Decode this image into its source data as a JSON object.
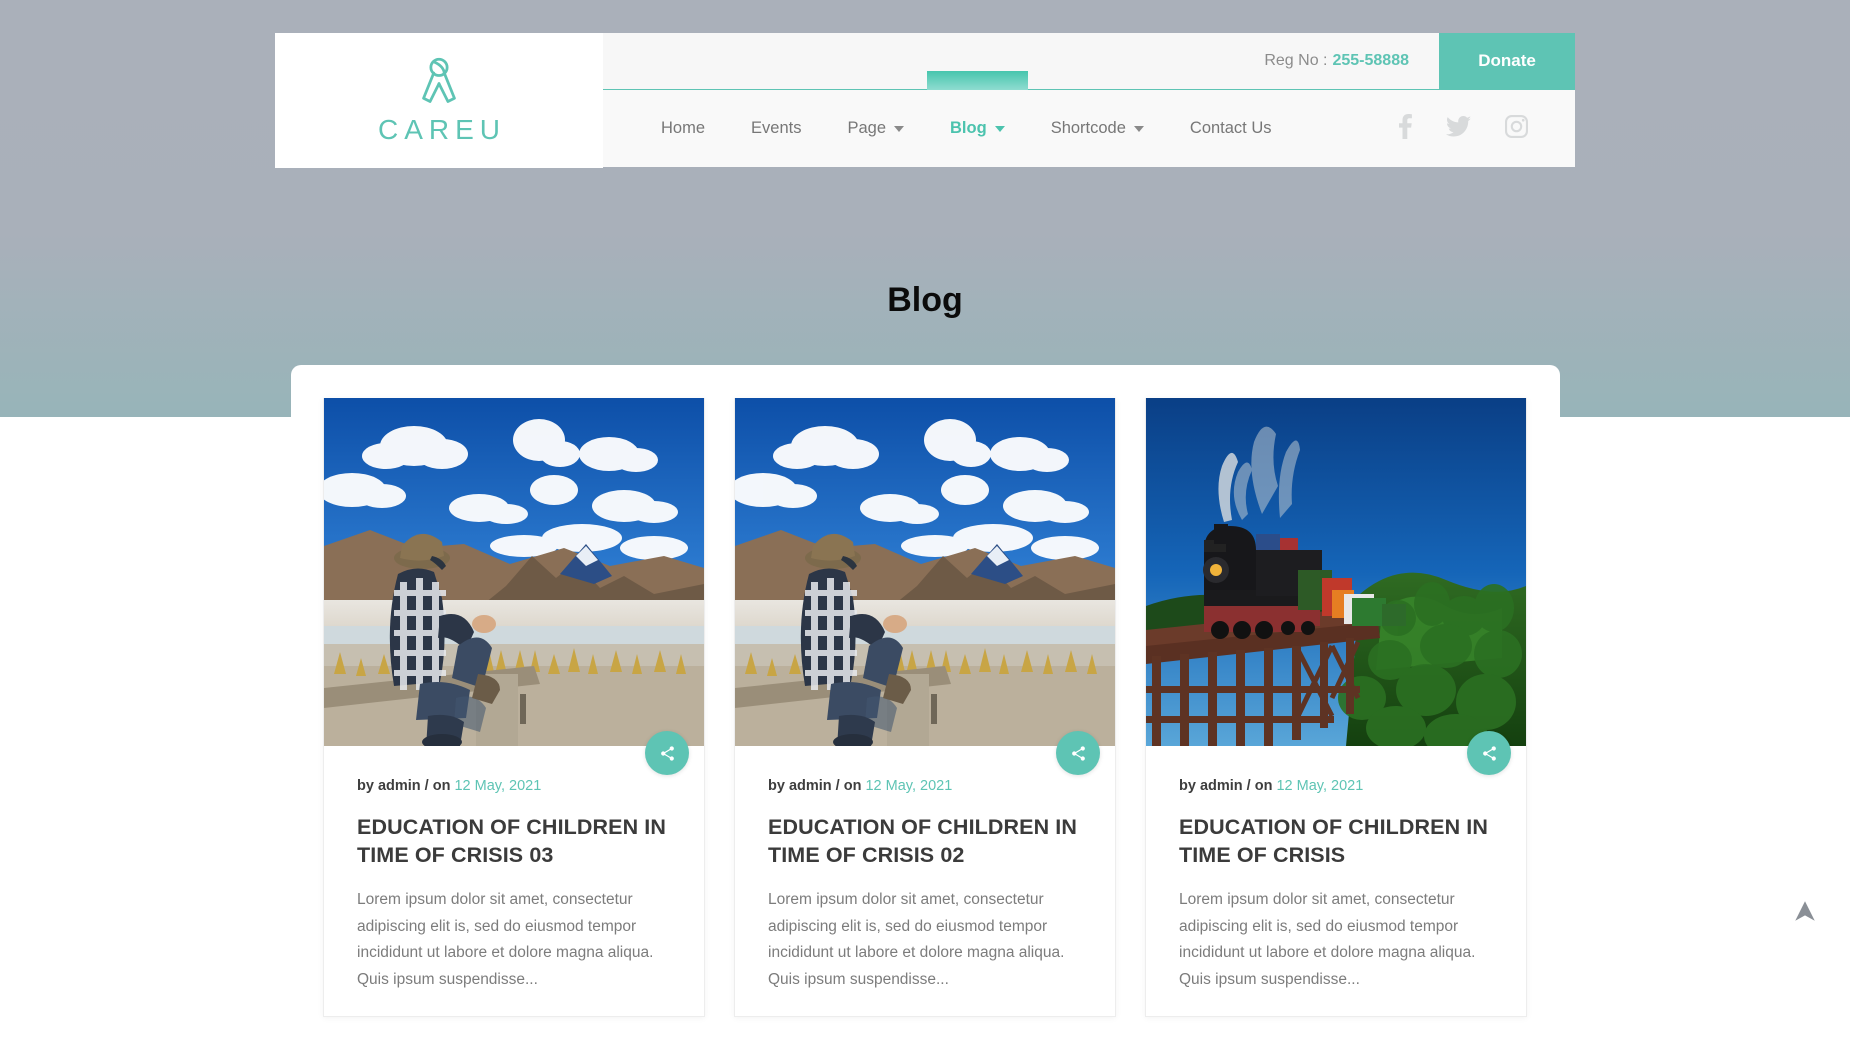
{
  "header": {
    "logo": {
      "icon": "ribbon-icon",
      "brand": "CAREU"
    },
    "topbar": {
      "reg_label": "Reg No :",
      "reg_value": "255-58888",
      "donate_label": "Donate"
    },
    "nav": [
      {
        "label": "Home",
        "has_caret": false,
        "active": false
      },
      {
        "label": "Events",
        "has_caret": false,
        "active": false
      },
      {
        "label": "Page",
        "has_caret": true,
        "active": false
      },
      {
        "label": "Blog",
        "has_caret": true,
        "active": true
      },
      {
        "label": "Shortcode",
        "has_caret": true,
        "active": false
      },
      {
        "label": "Contact Us",
        "has_caret": false,
        "active": false
      }
    ],
    "social": [
      {
        "name": "facebook-icon"
      },
      {
        "name": "twitter-icon"
      },
      {
        "name": "instagram-icon"
      }
    ]
  },
  "hero": {
    "title": "Blog"
  },
  "blog": {
    "posts": [
      {
        "image_alt": "man-in-plaid-shirt-sitting-on-bench-by-salt-lake",
        "meta_author": "by admin / on",
        "meta_date": "12 May, 2021",
        "title": "EDUCATION OF CHILDREN IN TIME OF CRISIS 03",
        "excerpt": "Lorem ipsum dolor sit amet, consectetur adipiscing elit is, sed do eiusmod tempor incididunt ut labore et dolore magna aliqua. Quis ipsum suspendisse...",
        "share_label": "share-icon"
      },
      {
        "image_alt": "man-in-plaid-shirt-sitting-on-bench-by-salt-lake",
        "meta_author": "by admin / on",
        "meta_date": "12 May, 2021",
        "title": "EDUCATION OF CHILDREN IN TIME OF CRISIS 02",
        "excerpt": "Lorem ipsum dolor sit amet, consectetur adipiscing elit is, sed do eiusmod tempor incididunt ut labore et dolore magna aliqua. Quis ipsum suspendisse...",
        "share_label": "share-icon"
      },
      {
        "image_alt": "steam-locomotive-crossing-trestle-bridge-over-forest",
        "meta_author": "by admin / on",
        "meta_date": "12 May, 2021",
        "title": "EDUCATION OF CHILDREN IN TIME OF CRISIS",
        "excerpt": "Lorem ipsum dolor sit amet, consectetur adipiscing elit is, sed do eiusmod tempor incididunt ut labore et dolore magna aliqua. Quis ipsum suspendisse...",
        "share_label": "share-icon"
      }
    ]
  },
  "scroll_top": {
    "icon": "arrow-up-icon"
  },
  "colors": {
    "accent_teal": "#5ec4b4",
    "nav_active": "#4cc3ae",
    "bg_gradient_top": "#aab0ba",
    "bg_gradient_bottom": "#60cabb",
    "text_dark": "#3b3b3b",
    "text_muted": "#7c7c7c"
  }
}
